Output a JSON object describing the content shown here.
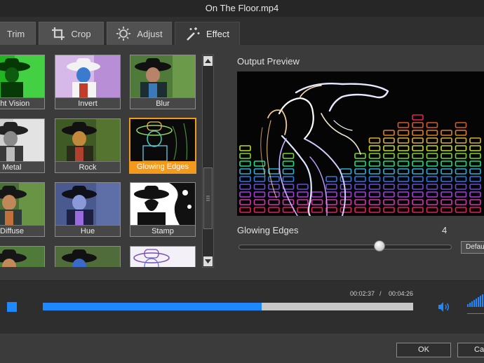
{
  "window": {
    "title": "On The Floor.mp4"
  },
  "tabs": [
    {
      "label": "Trim",
      "icon": "scissors-icon"
    },
    {
      "label": "Crop",
      "icon": "crop-icon"
    },
    {
      "label": "Adjust",
      "icon": "brightness-icon"
    },
    {
      "label": "Effect",
      "icon": "magic-wand-icon",
      "active": true
    }
  ],
  "effects": [
    {
      "label": "ight Vision"
    },
    {
      "label": "Invert"
    },
    {
      "label": "Blur"
    },
    {
      "label": "Metal"
    },
    {
      "label": "Rock"
    },
    {
      "label": "Glowing Edges",
      "selected": true
    },
    {
      "label": "Diffuse"
    },
    {
      "label": "Hue"
    },
    {
      "label": "Stamp"
    },
    {
      "label": ""
    },
    {
      "label": ""
    },
    {
      "label": ""
    }
  ],
  "preview": {
    "label": "Output Preview",
    "effect_name": "Glowing Edges",
    "effect_value": "4",
    "slider_fraction": 0.66,
    "default_label": "Default"
  },
  "playback": {
    "current_time": "00:02:37",
    "separator": "/",
    "total_time": "00:04:26",
    "progress_fraction": 0.59,
    "accent_color": "#1e88ff"
  },
  "footer": {
    "ok_label": "OK",
    "cancel_label": "Cancel"
  }
}
